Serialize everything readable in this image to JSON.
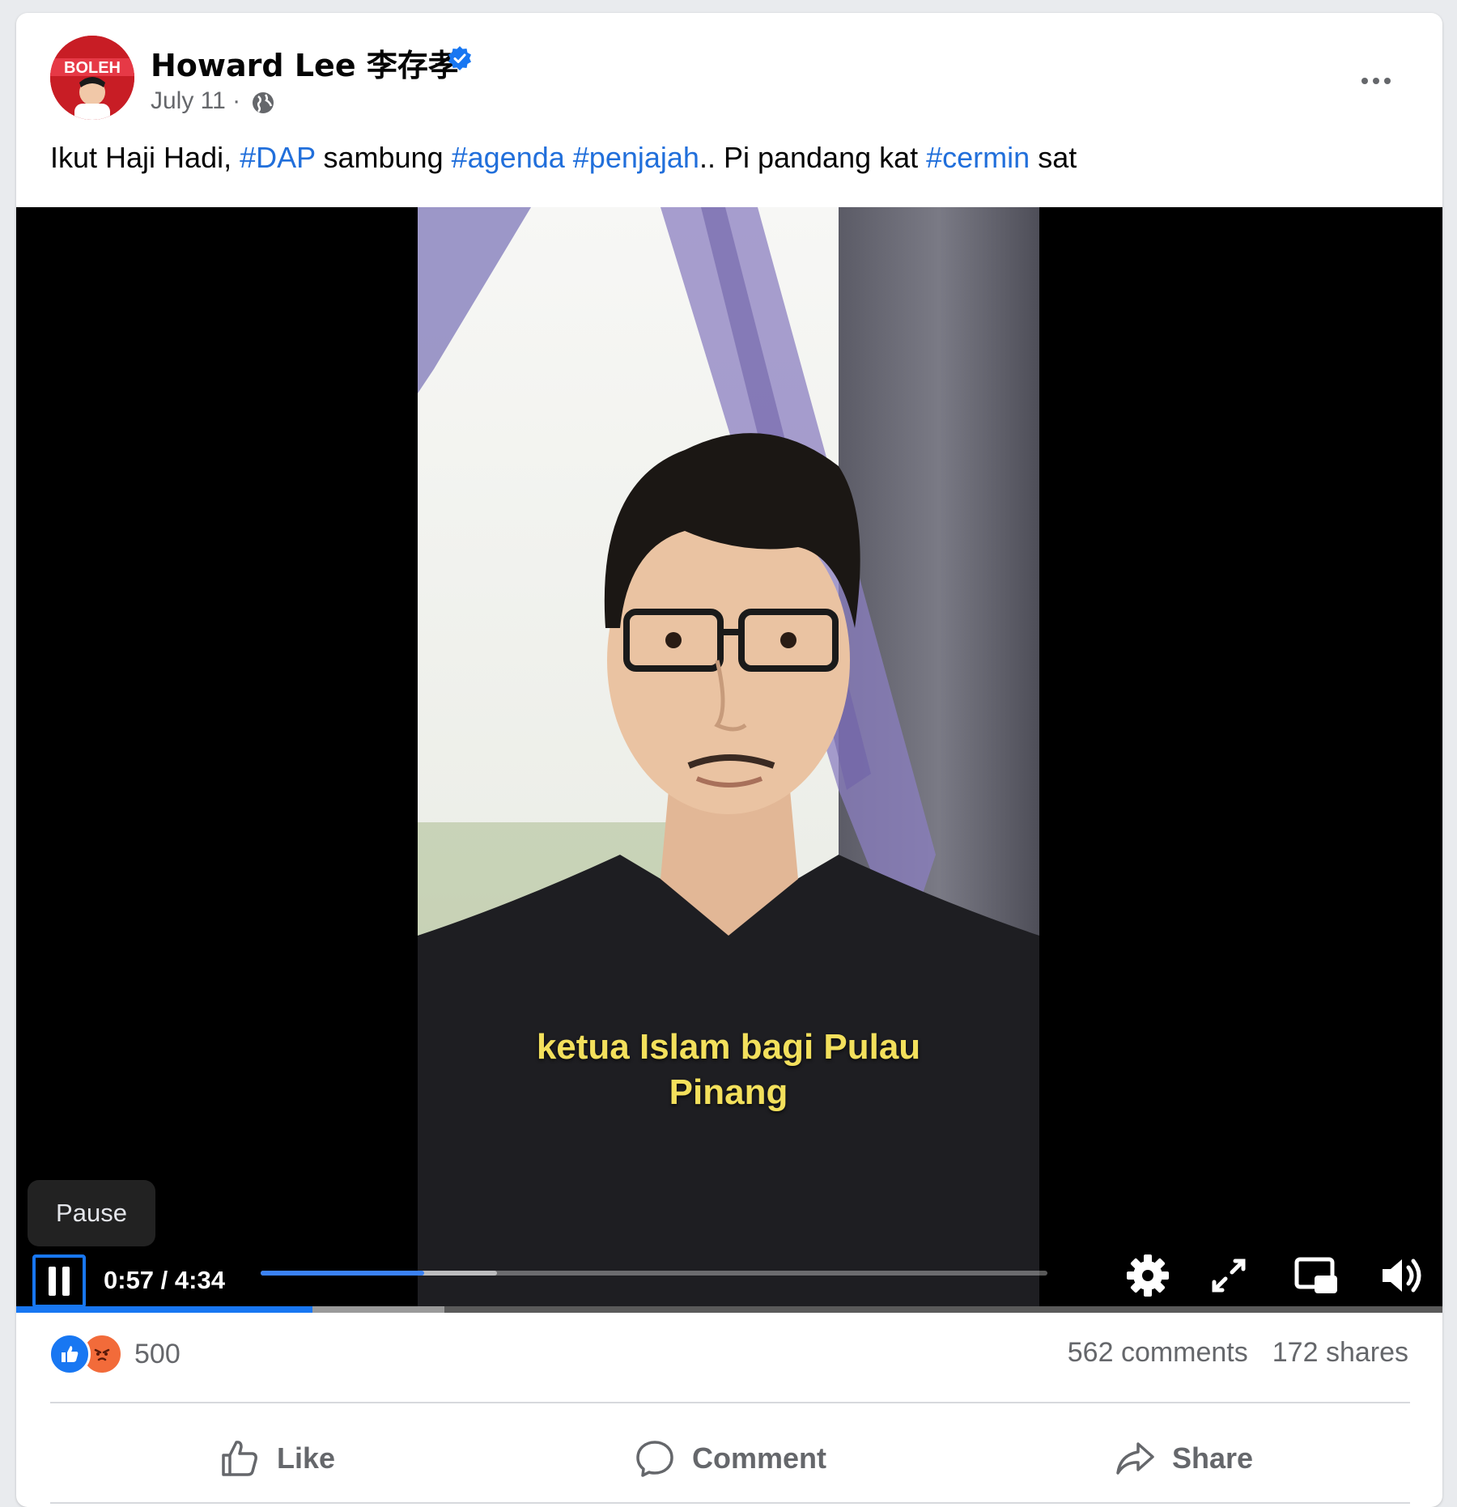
{
  "post": {
    "author": "Howard Lee 李存孝",
    "avatar_text": "BOLEH",
    "date": "July 11",
    "date_separator": "·",
    "audience_icon": "globe-icon",
    "verified_icon": "verified-badge-icon",
    "more_icon": "more-options-icon",
    "caption": {
      "part1": "Ikut Haji Hadi, ",
      "tag1": "#DAP",
      "part2": " sambung ",
      "tag2": "#agenda",
      "part3": " ",
      "tag3": "#penjajah",
      "part4": ".. Pi pandang kat ",
      "tag4": "#cermin",
      "part5": " sat"
    }
  },
  "video": {
    "subtitle_line1": "ketua Islam bagi Pulau",
    "subtitle_line2": "Pinang",
    "tooltip": "Pause",
    "current_time": "0:57",
    "time_separator": " / ",
    "duration": "4:34",
    "played_fraction": 0.208,
    "buffered_fraction": 0.3,
    "controls": [
      "pause-icon",
      "settings-gear-icon",
      "fullscreen-icon",
      "picture-in-picture-icon",
      "volume-icon"
    ]
  },
  "engagement": {
    "reactions": [
      "like-reaction-icon",
      "angry-reaction-icon"
    ],
    "reaction_count": "500",
    "comments": "562 comments",
    "shares": "172 shares"
  },
  "actions": {
    "like": "Like",
    "comment": "Comment",
    "share": "Share"
  },
  "colors": {
    "link": "#216fdb",
    "accent": "#1877f2",
    "subtitle": "#f3e05c",
    "angry": "#f26b3a"
  }
}
